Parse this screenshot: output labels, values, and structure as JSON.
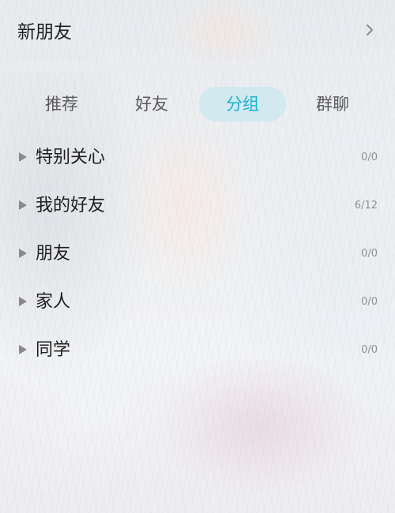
{
  "new_friends": {
    "label": "新朋友"
  },
  "tabs": [
    {
      "label": "推荐",
      "selected": false
    },
    {
      "label": "好友",
      "selected": false
    },
    {
      "label": "分组",
      "selected": true
    },
    {
      "label": "群聊",
      "selected": false
    }
  ],
  "groups": [
    {
      "name": "特别关心",
      "count": "0/0"
    },
    {
      "name": "我的好友",
      "count": "6/12"
    },
    {
      "name": "朋友",
      "count": "0/0"
    },
    {
      "name": "家人",
      "count": "0/0"
    },
    {
      "name": "同学",
      "count": "0/0"
    }
  ],
  "colors": {
    "accent": "#18b4d8",
    "selected_tab_bg": "#cde8ee"
  },
  "icons": {
    "new_friends_chevron": "chevron-right-icon",
    "group_expand": "triangle-right-icon"
  }
}
